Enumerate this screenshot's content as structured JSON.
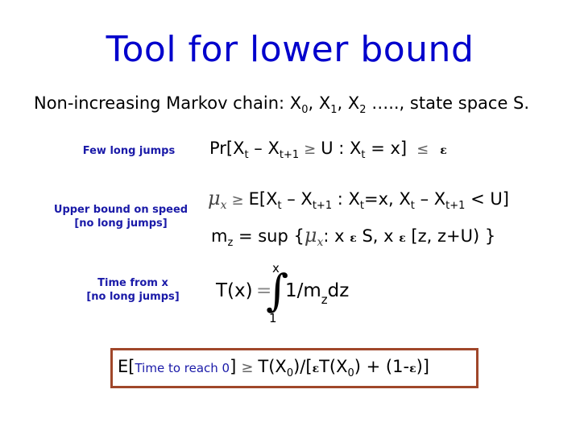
{
  "title": "Tool for lower bound",
  "subtitle": {
    "prefix": "Non-increasing Markov chain: ",
    "x": "X",
    "s0": "0",
    "s1": "1",
    "s2": "2",
    "suffix": " ….., state space S."
  },
  "rows": {
    "few_long_jumps": {
      "label": "Few long jumps",
      "formula_a": "Pr[X",
      "sub_t": "t",
      "formula_b": " – X",
      "sub_t1": "t+1",
      "geq": "≥",
      "formula_c": "U : X",
      "formula_d": " = x]",
      "leq": "≤",
      "eps": "ε"
    },
    "upper_bound_speed": {
      "label_line1": "Upper bound on speed",
      "label_line2": "[no long jumps]",
      "mu": "μ",
      "mu_sub": "x",
      "geq": "≥",
      "formula": "E[X",
      "sub_t": "t",
      "part2": " – X",
      "sub_t1": "t+1",
      "part3": " : X",
      "part4": "=x, X",
      "part5": " – X",
      "part6": " < U]",
      "m_line_a": "m",
      "m_sub": "z",
      "m_line_b": " = sup {",
      "m_line_c": ": x ",
      "in1": "ε",
      "m_line_d": " S, x ",
      "in2": "ε",
      "m_line_e": " [z, z+U) }"
    },
    "time_from_x": {
      "label_line1": "Time from x",
      "label_line2": "[no long jumps]",
      "lhs": "T(x)",
      "eq": "=",
      "integral": "∫",
      "upper": "x",
      "lower": "1",
      "integrand_a": "1/m",
      "integrand_sub": "z",
      "integrand_b": "dz"
    }
  },
  "boxed": {
    "open": "E[",
    "blue_text": "Time to reach 0",
    "close": "]",
    "geq": "≥",
    "rhs_a": "T(X",
    "sub0": "0",
    "rhs_b": ")/[",
    "eps1": "ε",
    "rhs_c": "T(X",
    "rhs_d": ") + (1-",
    "eps2": "ε",
    "rhs_e": ")]"
  },
  "colors": {
    "title": "#0000cc",
    "label": "#1a1aa8",
    "box_border": "#a0472a"
  }
}
